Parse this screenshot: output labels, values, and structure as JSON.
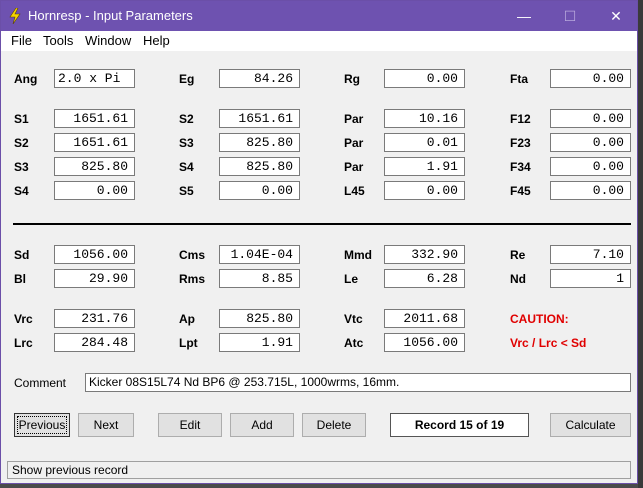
{
  "window": {
    "title": "Hornresp - Input Parameters",
    "minimize": "—",
    "maximize": "☐",
    "close": "✕"
  },
  "menu": [
    "File",
    "Tools",
    "Window",
    "Help"
  ],
  "row_ang": {
    "Ang": "Ang",
    "Ang_val": "2.0 x Pi",
    "Eg": "Eg",
    "Eg_val": "84.26",
    "Rg": "Rg",
    "Rg_val": "0.00",
    "Fta": "Fta",
    "Fta_val": "0.00"
  },
  "segments": [
    {
      "c1": "S1",
      "v1": "1651.61",
      "c2": "S2",
      "v2": "1651.61",
      "c3": "Par",
      "v3": "10.16",
      "c4": "F12",
      "v4": "0.00"
    },
    {
      "c1": "S2",
      "v1": "1651.61",
      "c2": "S3",
      "v2": "825.80",
      "c3": "Par",
      "v3": "0.01",
      "c4": "F23",
      "v4": "0.00"
    },
    {
      "c1": "S3",
      "v1": "825.80",
      "c2": "S4",
      "v2": "825.80",
      "c3": "Par",
      "v3": "1.91",
      "c4": "F34",
      "v4": "0.00"
    },
    {
      "c1": "S4",
      "v1": "0.00",
      "c2": "S5",
      "v2": "0.00",
      "c3": "L45",
      "v3": "0.00",
      "c4": "F45",
      "v4": "0.00"
    }
  ],
  "driver": [
    {
      "c1": "Sd",
      "v1": "1056.00",
      "c2": "Cms",
      "v2": "1.04E-04",
      "c3": "Mmd",
      "v3": "332.90",
      "c4": "Re",
      "v4": "7.10"
    },
    {
      "c1": "Bl",
      "v1": "29.90",
      "c2": "Rms",
      "v2": "8.85",
      "c3": "Le",
      "v3": "6.28",
      "c4": "Nd",
      "v4": "1"
    }
  ],
  "chamber": [
    {
      "c1": "Vrc",
      "v1": "231.76",
      "c2": "Ap",
      "v2": "825.80",
      "c3": "Vtc",
      "v3": "2011.68"
    },
    {
      "c1": "Lrc",
      "v1": "284.48",
      "c2": "Lpt",
      "v2": "1.91",
      "c3": "Atc",
      "v3": "1056.00"
    }
  ],
  "caution": {
    "title": "CAUTION:",
    "message": "Vrc / Lrc < Sd"
  },
  "comment": {
    "label": "Comment",
    "value": "Kicker 08S15L74 Nd BP6 @ 253.715L, 1000wrms, 16mm."
  },
  "buttons": {
    "previous": "Previous",
    "next": "Next",
    "edit": "Edit",
    "add": "Add",
    "delete": "Delete",
    "calculate": "Calculate"
  },
  "record": "Record 15 of 19",
  "status": "Show previous record",
  "colors": {
    "titlebar": "#6e52b0",
    "caution": "#e00000"
  }
}
